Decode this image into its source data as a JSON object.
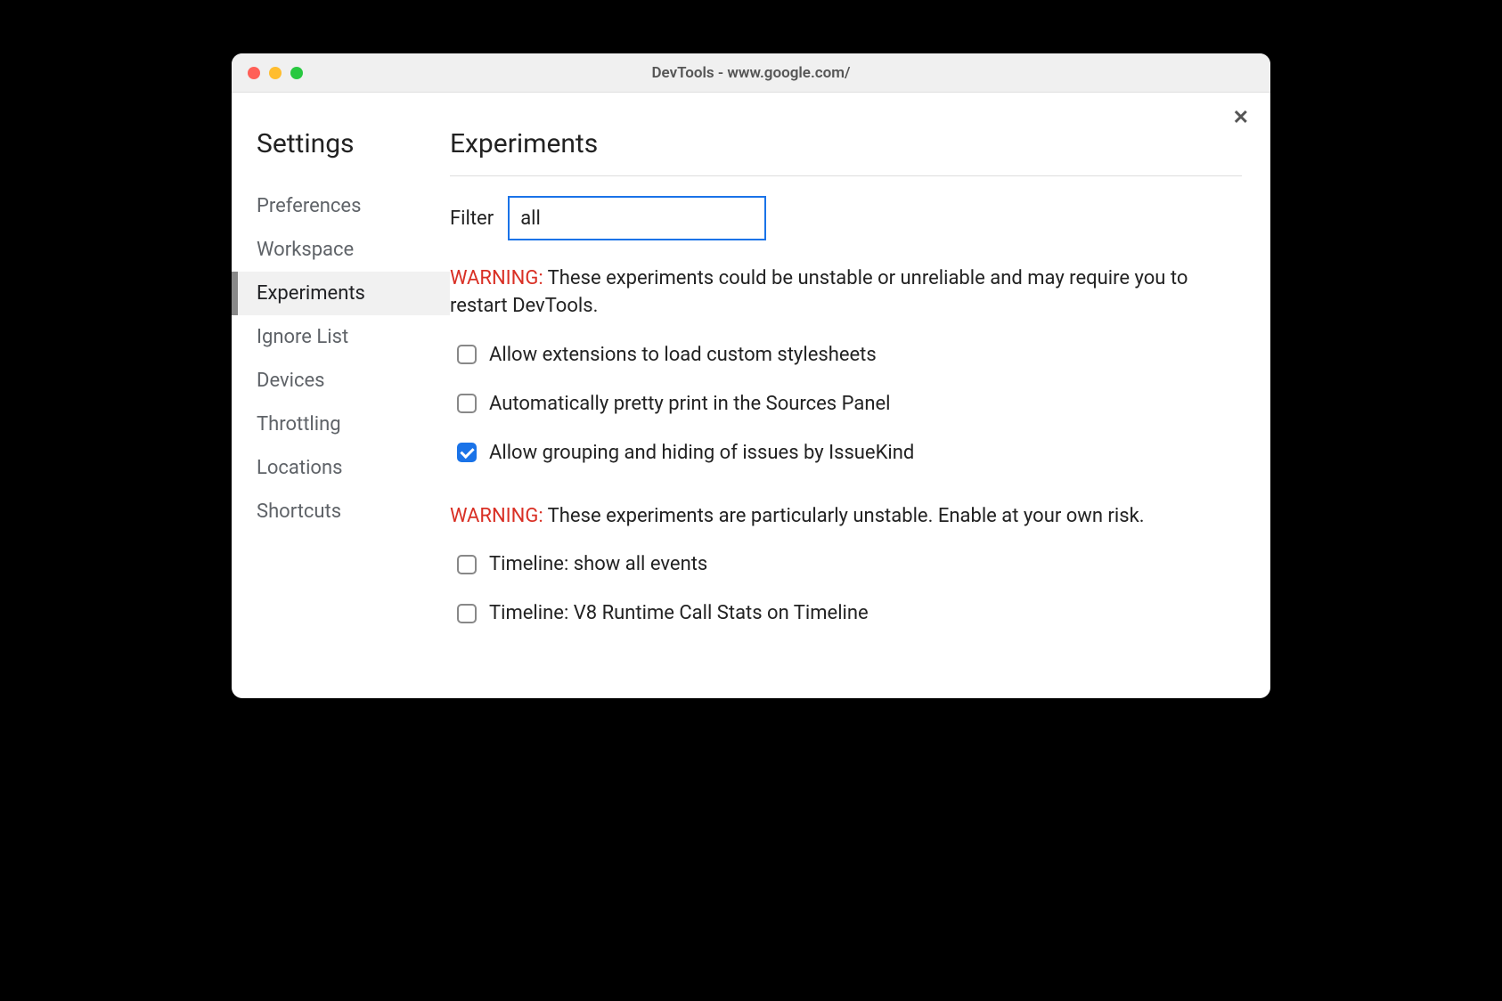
{
  "window": {
    "title": "DevTools - www.google.com/"
  },
  "sidebar": {
    "title": "Settings",
    "items": [
      {
        "label": "Preferences",
        "active": false
      },
      {
        "label": "Workspace",
        "active": false
      },
      {
        "label": "Experiments",
        "active": true
      },
      {
        "label": "Ignore List",
        "active": false
      },
      {
        "label": "Devices",
        "active": false
      },
      {
        "label": "Throttling",
        "active": false
      },
      {
        "label": "Locations",
        "active": false
      },
      {
        "label": "Shortcuts",
        "active": false
      }
    ]
  },
  "main": {
    "title": "Experiments",
    "filter": {
      "label": "Filter",
      "value": "all"
    },
    "warning1": {
      "label": "WARNING:",
      "text": " These experiments could be unstable or unreliable and may require you to restart DevTools."
    },
    "experiments1": [
      {
        "label": "Allow extensions to load custom stylesheets",
        "checked": false
      },
      {
        "label": "Automatically pretty print in the Sources Panel",
        "checked": false
      },
      {
        "label": "Allow grouping and hiding of issues by IssueKind",
        "checked": true
      }
    ],
    "warning2": {
      "label": "WARNING:",
      "text": " These experiments are particularly unstable. Enable at your own risk."
    },
    "experiments2": [
      {
        "label": "Timeline: show all events",
        "checked": false
      },
      {
        "label": "Timeline: V8 Runtime Call Stats on Timeline",
        "checked": false
      }
    ]
  }
}
